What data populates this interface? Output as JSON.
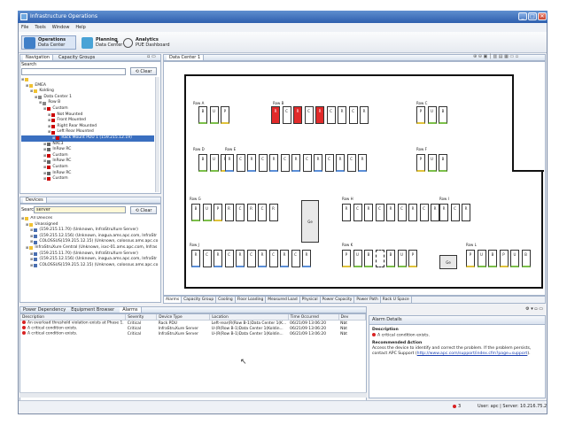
{
  "window": {
    "title": "Infrastructure Operations",
    "min": "_",
    "max": "□",
    "close": "✕"
  },
  "menu": [
    "File",
    "Tools",
    "Window",
    "Help"
  ],
  "perspectives": [
    {
      "title": "Operations",
      "sub": "Data Center",
      "color": "#3f7fc8"
    },
    {
      "title": "Planning",
      "sub": "Data Center",
      "color": "#49a3d6"
    },
    {
      "title": "Analytics",
      "sub": "PUE Dashboard",
      "color": "#d87b2a"
    }
  ],
  "nav": {
    "tabs": [
      "Navigation",
      "Capacity Groups"
    ],
    "search_label": "Search",
    "clear": "Clear",
    "tree": [
      {
        "d": 0,
        "t": "",
        "c": "#f1c232"
      },
      {
        "d": 1,
        "t": "EMEA",
        "c": "#f1c232"
      },
      {
        "d": 2,
        "t": "Kolding",
        "c": "#f1c232"
      },
      {
        "d": 3,
        "t": "Data Center 1",
        "c": "#888"
      },
      {
        "d": 4,
        "t": "Row B",
        "c": "#888"
      },
      {
        "d": 5,
        "t": "Custom",
        "c": "#c00"
      },
      {
        "d": 6,
        "t": "Not Mounted",
        "c": "#c00"
      },
      {
        "d": 6,
        "t": "Front Mounted",
        "c": "#c00"
      },
      {
        "d": 6,
        "t": "Right Rear Mounted",
        "c": "#c00"
      },
      {
        "d": 6,
        "t": "Left Rear Mounted",
        "c": "#c00"
      },
      {
        "d": 7,
        "t": "Rack Mount PDU 1 (159.215.12.19)",
        "c": "#c00",
        "sel": true
      },
      {
        "d": 5,
        "t": "NXC3",
        "c": "#666"
      },
      {
        "d": 5,
        "t": "InRow RC",
        "c": "#666"
      },
      {
        "d": 5,
        "t": "Custom",
        "c": "#c00"
      },
      {
        "d": 5,
        "t": "InRow RC",
        "c": "#666"
      },
      {
        "d": 5,
        "t": "Custom",
        "c": "#c00"
      },
      {
        "d": 5,
        "t": "InRow RC",
        "c": "#666"
      },
      {
        "d": 5,
        "t": "Custom",
        "c": "#c00"
      }
    ]
  },
  "devices": {
    "tab": "Devices",
    "search_label": "Search",
    "search_value": "server",
    "clear": "Clear",
    "tree": [
      {
        "d": 0,
        "t": "All Devices",
        "c": "#f1c232"
      },
      {
        "d": 1,
        "t": "Unassigned",
        "c": "#f1c232"
      },
      {
        "d": 2,
        "t": "(159.215.11.70) (Unknown, InfraStruXure Server)",
        "c": "#4a6fb0"
      },
      {
        "d": 2,
        "t": "(159.215.12.156) (Unknown, inagua.ams.apc.com, InfraStr",
        "c": "#4a6fb0"
      },
      {
        "d": 2,
        "t": "COLOSSUS(159.215.12.15) (Unknown, colossus.ams.apc.co",
        "c": "#4a6fb0"
      },
      {
        "d": 1,
        "t": "InfraStruXure Central (Unknown, isxc-01.ams.apc.com, Infras",
        "c": "#f1c232"
      },
      {
        "d": 2,
        "t": "(159.215.11.70) (Unknown, InfraStruXure Server)",
        "c": "#4a6fb0"
      },
      {
        "d": 2,
        "t": "(159.215.12.156) (Unknown, inagua.ams.apc.com, InfraStr",
        "c": "#4a6fb0"
      },
      {
        "d": 2,
        "t": "COLOSSUS(159.215.12.15) (Unknown, colossus.ams.apc.co",
        "c": "#4a6fb0"
      }
    ]
  },
  "editor": {
    "tab": "Data Center 1"
  },
  "floor": {
    "rows": [
      {
        "label": "Row A",
        "racks": [
          "B",
          "U",
          "P"
        ],
        "cls": [
          "g",
          "g",
          "y"
        ]
      },
      {
        "label": "Row B",
        "racks": [
          "R",
          "C",
          "R",
          "C",
          "R",
          "C",
          "R",
          "C",
          "R"
        ],
        "cls": [
          "r",
          "",
          "r",
          "",
          "r",
          "",
          "",
          "",
          ""
        ]
      },
      {
        "label": "Row C",
        "racks": [
          "P",
          "U",
          "B"
        ],
        "cls": [
          "y",
          "g",
          "g"
        ]
      },
      {
        "label": "Row D",
        "racks": [
          "B",
          "U",
          "P"
        ],
        "cls": [
          "g",
          "g",
          "y"
        ]
      },
      {
        "label": "Row E",
        "racks": [
          "R",
          "C",
          "R",
          "C",
          "R",
          "C",
          "R",
          "C",
          "R",
          "C",
          "R",
          "C",
          "R"
        ],
        "cls": [
          "b",
          "",
          "b",
          "",
          "b",
          "",
          "b",
          "",
          "b",
          "",
          "b",
          "",
          "b"
        ]
      },
      {
        "label": "Row F",
        "racks": [
          "P",
          "U",
          "B"
        ],
        "cls": [
          "y",
          "g",
          "g"
        ]
      },
      {
        "label": "Row G",
        "racks": [
          "B",
          "U",
          "P",
          "R",
          "C",
          "R",
          "C",
          "R"
        ],
        "cls": [
          "g",
          "g",
          "y",
          "",
          "",
          "",
          "",
          ""
        ]
      },
      {
        "label": "Row H",
        "racks": [
          "R",
          "C",
          "R",
          "C",
          "R",
          "C",
          "R",
          "C",
          "R"
        ],
        "cls": [
          "",
          "",
          "",
          "",
          "",
          "",
          "",
          "",
          ""
        ]
      },
      {
        "label": "Row I",
        "racks": [
          "R",
          "C",
          "R"
        ],
        "cls": [
          "",
          "",
          ""
        ]
      },
      {
        "label": "Row J",
        "racks": [
          "R",
          "C",
          "R",
          "C",
          "R",
          "C",
          "R",
          "C",
          "R",
          "C",
          "R"
        ],
        "cls": [
          "b",
          "",
          "b",
          "",
          "b",
          "",
          "b",
          "",
          "b",
          "",
          "b"
        ]
      },
      {
        "label": "Row K",
        "racks": [
          "P",
          "U",
          "B",
          "",
          "B",
          "U",
          "P"
        ],
        "cls": [
          "y",
          "g",
          "g",
          "h",
          "g",
          "g",
          "y"
        ]
      },
      {
        "label": "Row L",
        "racks": [
          "P",
          "U",
          "B",
          "P",
          "U",
          "B"
        ],
        "cls": [
          "y",
          "g",
          "g",
          "y",
          "g",
          "g"
        ]
      }
    ],
    "block1": "Ge",
    "block2": "Ge"
  },
  "bottom_tabs": [
    "Alarms",
    "Capacity Group",
    "Cooling",
    "Floor Loading",
    "Measured Load",
    "Physical",
    "Power Capacity",
    "Power Path",
    "Rack U Space"
  ],
  "lower_tabs": [
    "Power Dependency",
    "Equipment Browser",
    "Alarms"
  ],
  "alarms": {
    "columns": [
      "Description",
      "Severity",
      "Device Type",
      "Location",
      "Time Occurred",
      "Dev"
    ],
    "rows": [
      [
        "An overload threshold violation exists at Phase 1.",
        "Critical",
        "Rack PDU",
        "Left-rear(R(Row B-1)Data Center 1(K...",
        "06/21/09 13:06:20",
        "Nbt"
      ],
      [
        "A critical condition exists.",
        "Critical",
        "InfraStruXure Server",
        "U-(R(Row B-1)Data Center 1(Koldin...",
        "06/21/09 13:06:20",
        "Nbt"
      ],
      [
        "A critical condition exists.",
        "Critical",
        "InfraStruXure Server",
        "U-(R(Row B-1)Data Center 1(Koldin...",
        "06/21/09 13:06:20",
        "Nbt"
      ]
    ]
  },
  "details": {
    "title": "Alarm Details",
    "desc_h": "Description",
    "desc": "A critical condition exists.",
    "action_h": "Recommended Action",
    "action": "Access the device to identify and correct the problem. If the problem persists, contact APC Support (",
    "link": "http://www.apc.com/support/index.cfm?page=support",
    "action_end": ")."
  },
  "status": {
    "alarm_count": "3",
    "user": "User: apc | Server: 10.216.75.2"
  }
}
